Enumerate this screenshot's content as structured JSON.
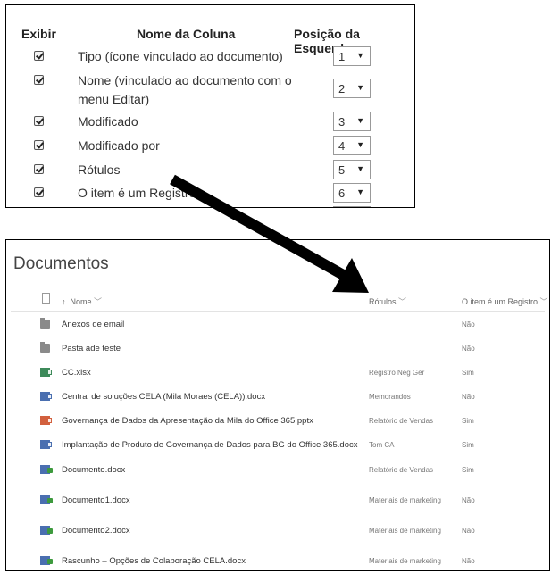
{
  "columns_panel": {
    "headers": {
      "show": "Exibir",
      "name": "Nome da Coluna",
      "position": "Posição da Esquerda"
    },
    "rows": [
      {
        "name": "Tipo (ícone vinculado ao documento)",
        "checked": true,
        "position": "1"
      },
      {
        "name": "Nome (vinculado ao documento com o menu Editar)",
        "checked": true,
        "position": "2"
      },
      {
        "name": "Modificado",
        "checked": true,
        "position": "3"
      },
      {
        "name": "Modificado por",
        "checked": true,
        "position": "4"
      },
      {
        "name": "Rótulos",
        "checked": true,
        "position": "5"
      },
      {
        "name": "O item é um Registro",
        "checked": true,
        "position": "6"
      }
    ]
  },
  "library": {
    "title": "Documentos",
    "columns": {
      "name": "Nome",
      "tags": "Rótulos",
      "record": "O item é um Registro"
    },
    "sort_icon": "↑",
    "chevron": "﹀",
    "items": [
      {
        "icon": "folder-icon",
        "name": "Anexos de email",
        "tag": "",
        "record": "Não"
      },
      {
        "icon": "folder-icon",
        "name": "Pasta ade teste",
        "tag": "",
        "record": "Não"
      },
      {
        "icon": "excel-icon",
        "name": "CC.xlsx",
        "tag": "Registro Neg Ger",
        "record": "Sim"
      },
      {
        "icon": "word-icon",
        "name": "Central de soluções CELA (Mila Moraes (CELA)).docx",
        "tag": "Memorandos",
        "record": "Não"
      },
      {
        "icon": "powerpoint-icon",
        "name": "Governança de Dados da Apresentação da Mila do Office 365.pptx",
        "tag": "Relatório de Vendas",
        "record": "Sim"
      },
      {
        "icon": "word-icon",
        "name": "Implantação de Produto de Governança de Dados para BG do Office 365.docx",
        "tag": "Tom CA",
        "record": "Sim"
      },
      {
        "icon": "word-record-icon",
        "name": "Documento.docx",
        "tag": "Relatório de Vendas",
        "record": "Sim"
      },
      {
        "icon": "word-record-icon",
        "name": "Documento1.docx",
        "tag": "Materiais de marketing",
        "record": "Não"
      },
      {
        "icon": "word-record-icon",
        "name": "Documento2.docx",
        "tag": "Materiais de marketing",
        "record": "Não"
      },
      {
        "icon": "word-record-icon",
        "name": "Rascunho – Opções de Colaboração CELA.docx",
        "tag": "Materiais de marketing",
        "record": "Não"
      }
    ]
  }
}
